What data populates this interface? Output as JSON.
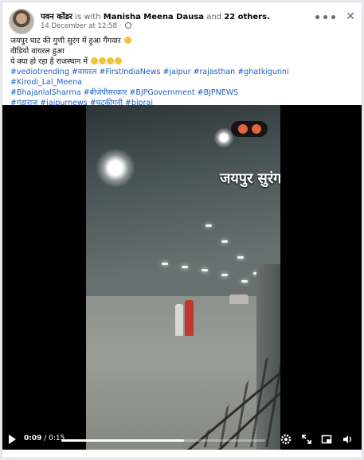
{
  "post": {
    "author": "पवन कोंडर",
    "with_text": "is with",
    "tagged": "Manisha Meena Dausa",
    "and_text": "and",
    "others": "22 others.",
    "timestamp": "14 December at 12:58",
    "dot": "·",
    "more_icon": "•••",
    "close_icon": "✕",
    "caption_lines": [
      "जयपुर घाट की गुणी सुरंग में हुआ गैंगवार",
      "वीडियो वायरल हुआ",
      "ये क्या हो रहा है राजस्थान में"
    ],
    "hashtags_line1": [
      "#vediotrending",
      "#वायरल",
      "#FirstIndiaNews",
      "#jaipur",
      "#rajasthan",
      "#ghatkigunni",
      "#Kirodi_Lal_Meena"
    ],
    "hashtags_line2": [
      "#BhajanlalSharma",
      "#बीजेपीसरकार",
      "#BJPGovernment",
      "#BJPNEWS"
    ],
    "hashtags_line3": [
      "#गुंडाराज",
      "#jaipurnews",
      "#घटकीगुनी",
      "#bjpraj"
    ]
  },
  "video": {
    "overlay_title": "जयपुर सुरंग",
    "current_time": "0:09",
    "duration": "/ 0:15",
    "progress": 0.6,
    "icons": [
      "play-icon",
      "settings-icon",
      "fullscreen-icon",
      "pip-icon",
      "volume-icon"
    ]
  },
  "colors": {
    "link": "#1d5fbf",
    "emoji": "#f5c23c",
    "angry_emoji": "#e0643c"
  }
}
